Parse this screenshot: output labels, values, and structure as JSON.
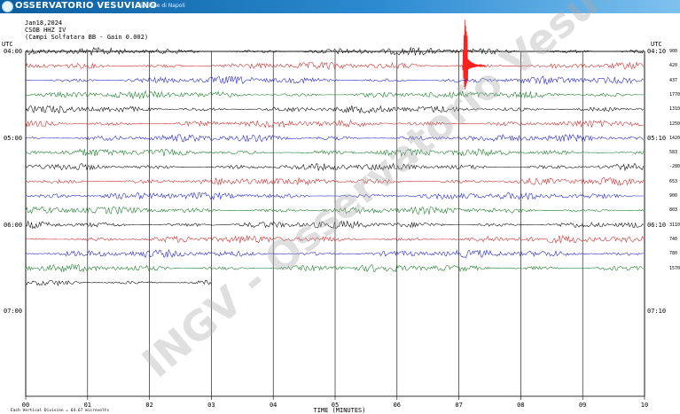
{
  "header": {
    "brand": "OSSERVATORIO VESUVIANO",
    "subbrand": "Sezione di Napoli",
    "date": "Jan18,2024",
    "station": "CSOB HHZ IV",
    "subtitle": "(Campi Solfatara BB - Gain 0.002)"
  },
  "utc_left": "UTC",
  "utc_right": "UTC",
  "time_labels_left": [
    "04:00",
    "05:00",
    "06:00",
    "07:00"
  ],
  "time_labels_right": [
    "04:10",
    "05:10",
    "06:10",
    "07:10"
  ],
  "right_values": [
    "900",
    "420",
    "437",
    "1770",
    "1310",
    "1250",
    "1420",
    "583",
    "-2800",
    "653",
    "900",
    "803",
    "3110",
    "740",
    "780",
    "1570"
  ],
  "x_ticks": [
    "00",
    "01",
    "02",
    "03",
    "04",
    "05",
    "06",
    "07",
    "08",
    "09",
    "10"
  ],
  "x_axis_title": "TIME (MINUTES)",
  "footnote": "Each Vertical Division =   64.67 microvolts",
  "watermark_text": "INGV - Osservatorio Vesuviano",
  "colors": {
    "trace_cycle": [
      "#000000",
      "#cc2222",
      "#1a1acc",
      "#117722"
    ],
    "brand_bar": "#1b6fb3",
    "event_spike": "#ff2020"
  },
  "chart_data": {
    "type": "line",
    "x_label": "TIME (MINUTES)",
    "xlim": [
      0,
      10
    ],
    "rows": 17,
    "row_minutes": 10,
    "last_row_end_minute": 3.0,
    "event": {
      "row": 1,
      "minute": 7.1
    }
  }
}
